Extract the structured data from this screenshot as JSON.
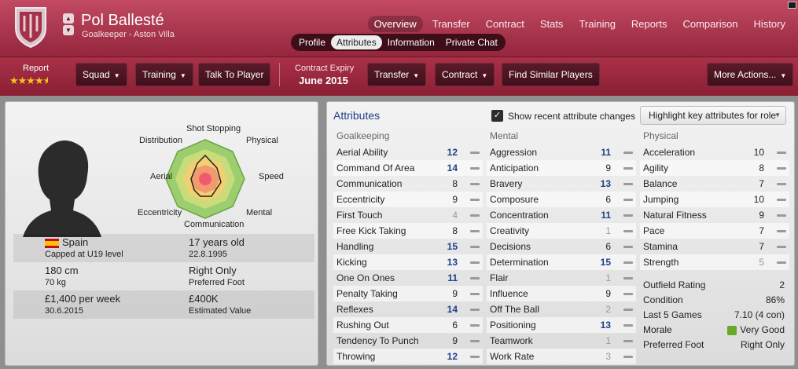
{
  "player": {
    "name": "Pol Ballesté",
    "subtitle": "Goalkeeper - Aston Villa"
  },
  "topnav": [
    "Overview",
    "Transfer",
    "Contract",
    "Stats",
    "Training",
    "Reports",
    "Comparison",
    "History"
  ],
  "subnav": [
    "Profile",
    "Attributes",
    "Information",
    "Private Chat"
  ],
  "report": {
    "label": "Report",
    "stars": 4.5
  },
  "buttons": {
    "squad": "Squad",
    "training": "Training",
    "talk": "Talk To Player",
    "transfer": "Transfer",
    "contract": "Contract",
    "similar": "Find Similar Players",
    "more": "More Actions..."
  },
  "contract_expiry": {
    "label": "Contract Expiry",
    "value": "June 2015"
  },
  "polar_labels": {
    "top": "Shot Stopping",
    "tr": "Physical",
    "r": "Speed",
    "br": "Mental",
    "bottom": "Communication",
    "bl": "Eccentricity",
    "l": "Aerial",
    "tl": "Distribution"
  },
  "info": {
    "nation": "Spain",
    "capped": "Capped at U19 level",
    "age": "17 years old",
    "dob": "22.8.1995",
    "height": "180 cm",
    "weight": "70 kg",
    "foot": "Right Only",
    "foot_label": "Preferred Foot",
    "wage": "£1,400 per week",
    "wage_date": "30.6.2015",
    "value": "£400K",
    "value_label": "Estimated Value"
  },
  "attributes_title": "Attributes",
  "show_changes": "Show recent attribute changes",
  "highlight": "Highlight key attributes for role",
  "goalkeeping": {
    "header": "Goalkeeping",
    "items": [
      {
        "name": "Aerial Ability",
        "value": "12",
        "style": "blue"
      },
      {
        "name": "Command Of Area",
        "value": "14",
        "style": "blue"
      },
      {
        "name": "Communication",
        "value": "8",
        "style": ""
      },
      {
        "name": "Eccentricity",
        "value": "9",
        "style": ""
      },
      {
        "name": "First Touch",
        "value": "4",
        "style": "grey"
      },
      {
        "name": "Free Kick Taking",
        "value": "8",
        "style": ""
      },
      {
        "name": "Handling",
        "value": "15",
        "style": "blue"
      },
      {
        "name": "Kicking",
        "value": "13",
        "style": "blue"
      },
      {
        "name": "One On Ones",
        "value": "11",
        "style": "blue"
      },
      {
        "name": "Penalty Taking",
        "value": "9",
        "style": ""
      },
      {
        "name": "Reflexes",
        "value": "14",
        "style": "blue"
      },
      {
        "name": "Rushing Out",
        "value": "6",
        "style": ""
      },
      {
        "name": "Tendency To Punch",
        "value": "9",
        "style": ""
      },
      {
        "name": "Throwing",
        "value": "12",
        "style": "blue"
      }
    ]
  },
  "mental": {
    "header": "Mental",
    "items": [
      {
        "name": "Aggression",
        "value": "11",
        "style": "blue"
      },
      {
        "name": "Anticipation",
        "value": "9",
        "style": ""
      },
      {
        "name": "Bravery",
        "value": "13",
        "style": "blue"
      },
      {
        "name": "Composure",
        "value": "6",
        "style": ""
      },
      {
        "name": "Concentration",
        "value": "11",
        "style": "blue"
      },
      {
        "name": "Creativity",
        "value": "1",
        "style": "grey"
      },
      {
        "name": "Decisions",
        "value": "6",
        "style": ""
      },
      {
        "name": "Determination",
        "value": "15",
        "style": "blue"
      },
      {
        "name": "Flair",
        "value": "1",
        "style": "grey"
      },
      {
        "name": "Influence",
        "value": "9",
        "style": ""
      },
      {
        "name": "Off The Ball",
        "value": "2",
        "style": "grey"
      },
      {
        "name": "Positioning",
        "value": "13",
        "style": "blue"
      },
      {
        "name": "Teamwork",
        "value": "1",
        "style": "grey"
      },
      {
        "name": "Work Rate",
        "value": "3",
        "style": "grey"
      }
    ]
  },
  "physical": {
    "header": "Physical",
    "items": [
      {
        "name": "Acceleration",
        "value": "10",
        "style": ""
      },
      {
        "name": "Agility",
        "value": "8",
        "style": ""
      },
      {
        "name": "Balance",
        "value": "7",
        "style": ""
      },
      {
        "name": "Jumping",
        "value": "10",
        "style": ""
      },
      {
        "name": "Natural Fitness",
        "value": "9",
        "style": ""
      },
      {
        "name": "Pace",
        "value": "7",
        "style": ""
      },
      {
        "name": "Stamina",
        "value": "7",
        "style": ""
      },
      {
        "name": "Strength",
        "value": "5",
        "style": "grey"
      }
    ]
  },
  "extra": {
    "outfield_label": "Outfield Rating",
    "outfield": "2",
    "condition_label": "Condition",
    "condition": "86%",
    "last5_label": "Last 5 Games",
    "last5": "7.10 (4 con)",
    "morale_label": "Morale",
    "morale": "Very Good",
    "foot_label": "Preferred Foot",
    "foot": "Right Only"
  }
}
